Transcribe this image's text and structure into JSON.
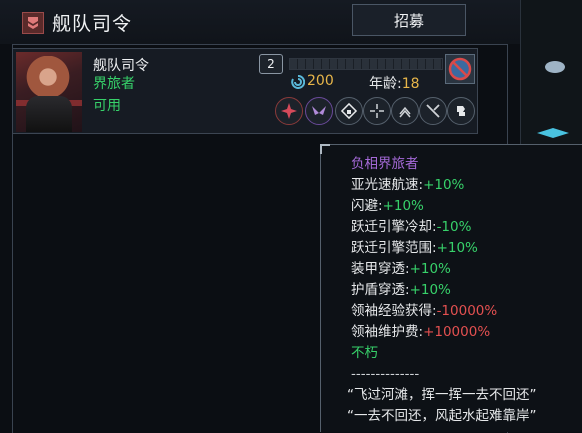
{
  "header": {
    "title": "舰队司令",
    "recruit_label": "招募"
  },
  "officer": {
    "name": "舰队司令",
    "class": "界旅者",
    "status": "可用",
    "level": "2",
    "xp_progress": 0.0,
    "cost": "200",
    "age_label": "年龄:",
    "age_value": "18",
    "skill_icons": [
      "starburst-icon",
      "wings-icon",
      "shield-icon",
      "crosshair-icon",
      "upgrade-arrow-icon",
      "blade-icon",
      "shield-swap-icon"
    ]
  },
  "tooltip": {
    "title": "负相界旅者",
    "stats": [
      {
        "label": "亚光速航速:",
        "value": "+10%",
        "positive": true
      },
      {
        "label": "闪避:",
        "value": "+10%",
        "positive": true
      },
      {
        "label": "跃迁引擎冷却:",
        "value": "-10%",
        "positive": true
      },
      {
        "label": "跃迁引擎范围:",
        "value": "+10%",
        "positive": true
      },
      {
        "label": "装甲穿透:",
        "value": "+10%",
        "positive": true
      },
      {
        "label": "护盾穿透:",
        "value": "+10%",
        "positive": true
      },
      {
        "label": "领袖经验获得:",
        "value": "-10000%",
        "positive": false
      },
      {
        "label": "领袖维护费:",
        "value": "+10000%",
        "positive": false
      }
    ],
    "trait": "不朽",
    "separator": "--------------",
    "quote1": "“飞过河滩，挥一挥一去不回还”",
    "quote2": "“一去不回还，风起水起难靠岸”"
  },
  "colors": {
    "positive": "#37d16a",
    "negative": "#e35050",
    "gold": "#e8b64a",
    "title_purple": "#a56ad8"
  }
}
